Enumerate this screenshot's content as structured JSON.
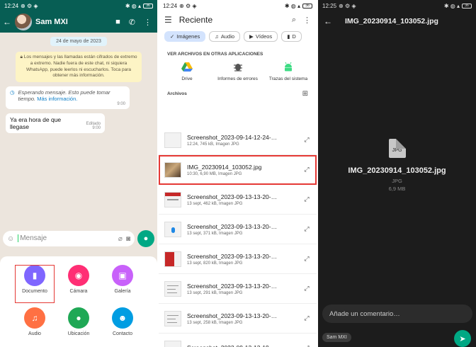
{
  "colors": {
    "wa_green": "#075e54",
    "accent": "#00a884",
    "highlight": "#e53935",
    "doc": "#7f66ff",
    "camera": "#ff2e74",
    "gallery": "#c861fa",
    "audio": "#ff7043",
    "location": "#1fa855",
    "contact": "#009de2"
  },
  "chat": {
    "status_time": "12:24",
    "contact_name": "Sam MXI",
    "date_chip": "24 de mayo de 2023",
    "encryption_notice": "Los mensajes y las llamadas están cifrados de extremo a extremo. Nadie fuera de este chat, ni siquiera WhatsApp, puede leerlos ni escucharlos. Toca para obtener más información.",
    "waiting_message": "Esperando mensaje. Esto puede tomar tiempo.",
    "waiting_link": "Más información.",
    "waiting_time": "9:00",
    "sent_message": "Ya era hora de que llegase",
    "sent_meta": "Editado 9:00",
    "input_placeholder": "Mensaje",
    "attach": [
      {
        "label": "Documento",
        "icon": "document-icon",
        "color": "#7f66ff",
        "glyph": "▮",
        "highlight": true
      },
      {
        "label": "Cámara",
        "icon": "camera-icon",
        "color": "#ff2e74",
        "glyph": "◉"
      },
      {
        "label": "Galería",
        "icon": "gallery-icon",
        "color": "#c861fa",
        "glyph": "▣"
      },
      {
        "label": "Audio",
        "icon": "headphones-icon",
        "color": "#ff7043",
        "glyph": "♫"
      },
      {
        "label": "Ubicación",
        "icon": "location-pin-icon",
        "color": "#1fa855",
        "glyph": "●"
      },
      {
        "label": "Contacto",
        "icon": "person-icon",
        "color": "#009de2",
        "glyph": "☻"
      }
    ]
  },
  "picker": {
    "status_time": "12:24",
    "title": "Reciente",
    "chips": [
      {
        "label": "Imágenes",
        "active": true,
        "glyph": "✓"
      },
      {
        "label": "Audio",
        "active": false,
        "glyph": "♫"
      },
      {
        "label": "Vídeos",
        "active": false,
        "glyph": "▶"
      },
      {
        "label": "D",
        "active": false,
        "glyph": "▮"
      }
    ],
    "other_apps_label": "VER ARCHIVOS EN OTRAS APLICACIONES",
    "apps": [
      {
        "label": "Drive",
        "icon": "google-drive-icon"
      },
      {
        "label": "Informes de errores",
        "icon": "bug-report-icon"
      },
      {
        "label": "Trazas del sistema",
        "icon": "android-icon"
      }
    ],
    "files_label": "Archivos",
    "files": [
      {
        "name": "Screenshot_2023-09-14-12-24-…",
        "meta": "12:24, 745 kB, Imagen JPG",
        "thumb": "plain",
        "highlight": false
      },
      {
        "name": "IMG_20230914_103052.jpg",
        "meta": "10:30, 6,90 MB, Imagen JPG",
        "thumb": "photo",
        "highlight": true
      },
      {
        "name": "Screenshot_2023-09-13-13-20-…",
        "meta": "13 sept, 462 kB, Imagen JPG",
        "thumb": "redbar",
        "highlight": false
      },
      {
        "name": "Screenshot_2023-09-13-13-20-…",
        "meta": "13 sept, 371 kB, Imagen JPG",
        "thumb": "bluepin",
        "highlight": false
      },
      {
        "name": "Screenshot_2023-09-13-13-20-…",
        "meta": "13 sept, 820 kB, Imagen JPG",
        "thumb": "redblock",
        "highlight": false
      },
      {
        "name": "Screenshot_2023-09-13-13-20-…",
        "meta": "13 sept, 291 kB, Imagen JPG",
        "thumb": "lines",
        "highlight": false
      },
      {
        "name": "Screenshot_2023-09-13-13-20-…",
        "meta": "13 sept, 258 kB, Imagen JPG",
        "thumb": "lines",
        "highlight": false
      },
      {
        "name": "Screenshot_2023-09-13-13-19-…",
        "meta": "",
        "thumb": "plain",
        "highlight": false
      }
    ]
  },
  "preview": {
    "status_time": "12:25",
    "title": "IMG_20230914_103052.jpg",
    "icon_label": "JPG",
    "file_name": "IMG_20230914_103052.jpg",
    "file_type": "JPG",
    "file_size": "6,9 MB",
    "comment_placeholder": "Añade un comentario…",
    "recipient": "Sam MXI"
  }
}
